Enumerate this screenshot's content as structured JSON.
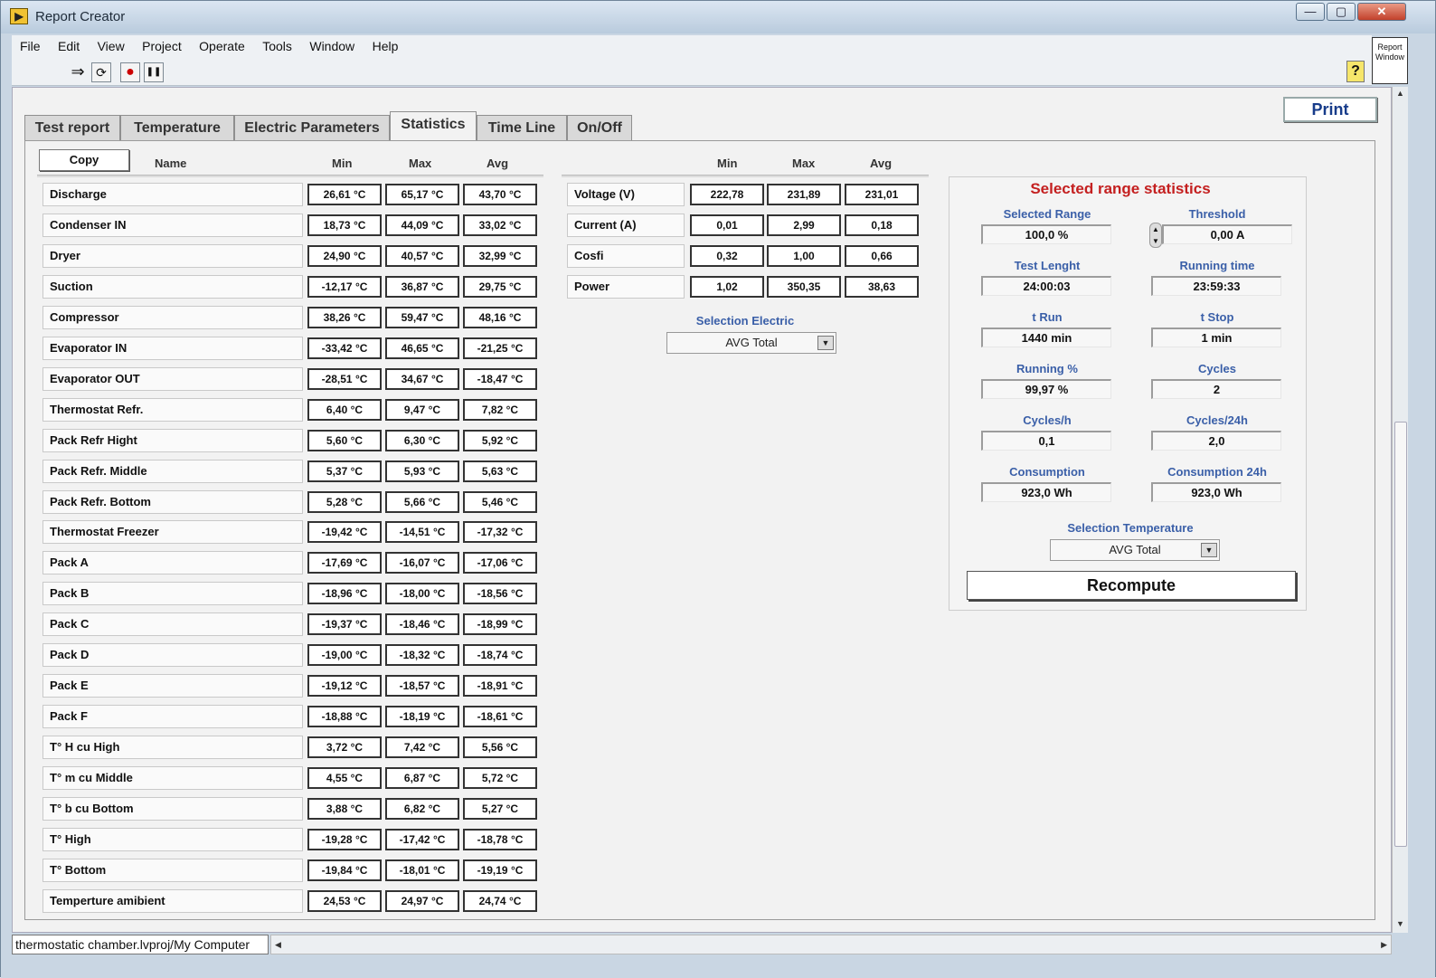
{
  "window": {
    "title": "Report Creator",
    "minimize": "—",
    "maximize": "▢",
    "close": "✕"
  },
  "menu": [
    "File",
    "Edit",
    "View",
    "Project",
    "Operate",
    "Tools",
    "Window",
    "Help"
  ],
  "toolbar": {
    "run": "⇒",
    "run_continuous": "⟳",
    "abort": "●",
    "pause": "❚❚",
    "help": "?"
  },
  "report_window_icon": "Report Window",
  "print_label": "Print",
  "tabs": [
    "Test report",
    "Temperature",
    "Electric Parameters",
    "Statistics",
    "Time Line",
    "On/Off"
  ],
  "active_tab": "Statistics",
  "temperature": {
    "copy_label": "Copy",
    "headers": {
      "name": "Name",
      "min": "Min",
      "max": "Max",
      "avg": "Avg"
    },
    "rows": [
      {
        "name": "Discharge",
        "min": "26,61 °C",
        "max": "65,17 °C",
        "avg": "43,70 °C"
      },
      {
        "name": "Condenser IN",
        "min": "18,73 °C",
        "max": "44,09 °C",
        "avg": "33,02 °C"
      },
      {
        "name": "Dryer",
        "min": "24,90 °C",
        "max": "40,57 °C",
        "avg": "32,99 °C"
      },
      {
        "name": "Suction",
        "min": "-12,17 °C",
        "max": "36,87 °C",
        "avg": "29,75 °C"
      },
      {
        "name": "Compressor",
        "min": "38,26 °C",
        "max": "59,47 °C",
        "avg": "48,16 °C"
      },
      {
        "name": "Evaporator IN",
        "min": "-33,42 °C",
        "max": "46,65 °C",
        "avg": "-21,25 °C"
      },
      {
        "name": "Evaporator OUT",
        "min": "-28,51 °C",
        "max": "34,67 °C",
        "avg": "-18,47 °C"
      },
      {
        "name": "Thermostat Refr.",
        "min": "6,40 °C",
        "max": "9,47 °C",
        "avg": "7,82 °C"
      },
      {
        "name": "Pack Refr Hight",
        "min": "5,60 °C",
        "max": "6,30 °C",
        "avg": "5,92 °C"
      },
      {
        "name": "Pack Refr. Middle",
        "min": "5,37 °C",
        "max": "5,93 °C",
        "avg": "5,63 °C"
      },
      {
        "name": "Pack Refr. Bottom",
        "min": "5,28 °C",
        "max": "5,66 °C",
        "avg": "5,46 °C"
      },
      {
        "name": "Thermostat Freezer",
        "min": "-19,42 °C",
        "max": "-14,51 °C",
        "avg": "-17,32 °C"
      },
      {
        "name": "Pack A",
        "min": "-17,69 °C",
        "max": "-16,07 °C",
        "avg": "-17,06 °C"
      },
      {
        "name": "Pack B",
        "min": "-18,96 °C",
        "max": "-18,00 °C",
        "avg": "-18,56 °C"
      },
      {
        "name": "Pack C",
        "min": "-19,37 °C",
        "max": "-18,46 °C",
        "avg": "-18,99 °C"
      },
      {
        "name": "Pack D",
        "min": "-19,00 °C",
        "max": "-18,32 °C",
        "avg": "-18,74 °C"
      },
      {
        "name": "Pack E",
        "min": "-19,12 °C",
        "max": "-18,57 °C",
        "avg": "-18,91 °C"
      },
      {
        "name": "Pack F",
        "min": "-18,88 °C",
        "max": "-18,19 °C",
        "avg": "-18,61 °C"
      },
      {
        "name": "T° H cu High",
        "min": "3,72 °C",
        "max": "7,42 °C",
        "avg": "5,56 °C"
      },
      {
        "name": "T° m cu Middle",
        "min": "4,55 °C",
        "max": "6,87 °C",
        "avg": "5,72 °C"
      },
      {
        "name": "T° b cu Bottom",
        "min": "3,88 °C",
        "max": "6,82 °C",
        "avg": "5,27 °C"
      },
      {
        "name": "T° High",
        "min": "-19,28 °C",
        "max": "-17,42 °C",
        "avg": "-18,78 °C"
      },
      {
        "name": "T° Bottom",
        "min": "-19,84 °C",
        "max": "-18,01 °C",
        "avg": "-19,19 °C"
      },
      {
        "name": "Temperture amibient",
        "min": "24,53 °C",
        "max": "24,97 °C",
        "avg": "24,74 °C"
      }
    ]
  },
  "electric": {
    "headers": {
      "min": "Min",
      "max": "Max",
      "avg": "Avg"
    },
    "rows": [
      {
        "name": "Voltage (V)",
        "min": "222,78",
        "max": "231,89",
        "avg": "231,01"
      },
      {
        "name": "Current (A)",
        "min": "0,01",
        "max": "2,99",
        "avg": "0,18"
      },
      {
        "name": "Cosfi",
        "min": "0,32",
        "max": "1,00",
        "avg": "0,66"
      },
      {
        "name": "Power",
        "min": "1,02",
        "max": "350,35",
        "avg": "38,63"
      }
    ],
    "selection_label": "Selection Electric",
    "selection_value": "AVG Total"
  },
  "range_stats": {
    "title": "Selected range statistics",
    "items": [
      {
        "label": "Selected Range",
        "value": "100,0 %"
      },
      {
        "label": "Threshold",
        "value": "0,00 A"
      },
      {
        "label": "Test Lenght",
        "value": "24:00:03"
      },
      {
        "label": "Running time",
        "value": "23:59:33"
      },
      {
        "label": "t Run",
        "value": "1440 min"
      },
      {
        "label": "t Stop",
        "value": "1 min"
      },
      {
        "label": "Running %",
        "value": "99,97 %"
      },
      {
        "label": "Cycles",
        "value": "2"
      },
      {
        "label": "Cycles/h",
        "value": "0,1"
      },
      {
        "label": "Cycles/24h",
        "value": "2,0"
      },
      {
        "label": "Consumption",
        "value": "923,0 Wh"
      },
      {
        "label": "Consumption 24h",
        "value": "923,0 Wh"
      }
    ],
    "selection_label": "Selection Temperature",
    "selection_value": "AVG Total",
    "recompute_label": "Recompute"
  },
  "status_path": "thermostatic chamber.lvproj/My Computer"
}
